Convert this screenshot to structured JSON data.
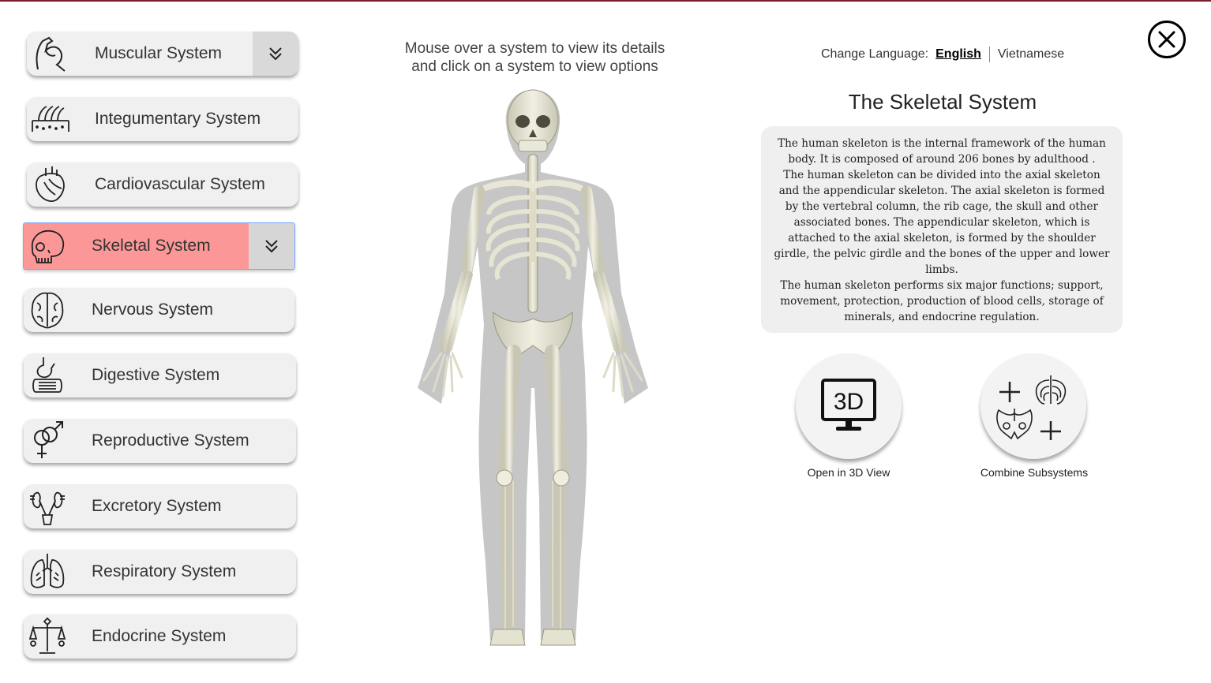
{
  "hint": {
    "line1": "Mouse over a system to view its details",
    "line2": "and click on a system to view options"
  },
  "language": {
    "label": "Change Language:",
    "current": "English",
    "other": "Vietnamese"
  },
  "systems": [
    {
      "label": "Muscular System",
      "icon": "muscle-arm-icon",
      "expanded_chevron": true
    },
    {
      "label": "Integumentary System",
      "icon": "skin-hair-icon"
    },
    {
      "label": "Cardiovascular System",
      "icon": "heart-icon"
    },
    {
      "label": "Skeletal System",
      "icon": "skull-icon",
      "active": true,
      "expanded_chevron": true
    },
    {
      "label": "Nervous System",
      "icon": "brain-icon"
    },
    {
      "label": "Digestive System",
      "icon": "digestive-tract-icon"
    },
    {
      "label": "Reproductive System",
      "icon": "gender-symbols-icon"
    },
    {
      "label": "Excretory System",
      "icon": "kidneys-icon"
    },
    {
      "label": "Respiratory System",
      "icon": "lungs-icon"
    },
    {
      "label": "Endocrine System",
      "icon": "balance-scale-icon"
    }
  ],
  "detail": {
    "title": "The Skeletal System",
    "description_lines": [
      "The human skeleton is the internal framework of the human",
      "body. It is composed of around 206 bones by adulthood .",
      "The human skeleton can be divided into the axial skeleton",
      "and the appendicular skeleton. The axial skeleton is formed",
      "by the vertebral column, the rib cage, the skull and other",
      "associated bones. The appendicular skeleton, which is",
      "attached to the axial skeleton, is formed by the shoulder",
      "girdle, the pelvic girdle and the bones of the upper and lower",
      "limbs.",
      "The human skeleton performs six major functions; support,",
      "movement, protection, production of blood cells, storage of",
      "minerals, and endocrine regulation."
    ]
  },
  "actions": {
    "open3d": {
      "label": "Open in 3D View",
      "icon_text": "3D"
    },
    "combine": {
      "label": "Combine Subsystems"
    }
  },
  "colors": {
    "active_button": "#fc9797",
    "button_bg": "#f0f0f0",
    "chevron_bg": "#d9d9d9",
    "frame_top": "#7a1f2b"
  }
}
